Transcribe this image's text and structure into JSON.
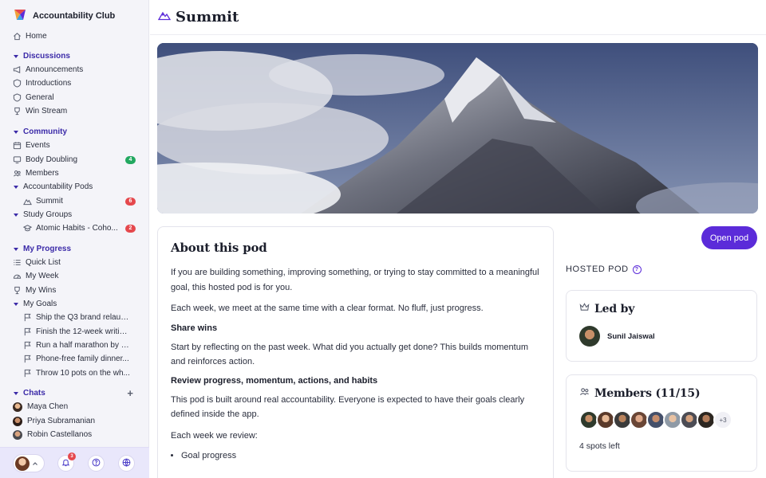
{
  "app": {
    "name": "Accountability Club"
  },
  "colors": {
    "accent": "#5b2bd9",
    "section": "#3b2aa8",
    "badge_green": "#22a860",
    "badge_red": "#e5484d"
  },
  "sidebar": {
    "home": "Home",
    "discussions": {
      "label": "Discussions",
      "items": [
        "Announcements",
        "Introductions",
        "General",
        "Win Stream"
      ]
    },
    "community": {
      "label": "Community",
      "events": "Events",
      "body_doubling": {
        "label": "Body Doubling",
        "badge": "4"
      },
      "members": "Members",
      "pods": {
        "label": "Accountability Pods",
        "items": [
          {
            "label": "Summit",
            "badge": "6"
          }
        ]
      },
      "study_groups": {
        "label": "Study Groups",
        "items": [
          {
            "label": "Atomic Habits - Coho...",
            "badge": "2"
          }
        ]
      }
    },
    "progress": {
      "label": "My Progress",
      "quick_list": "Quick List",
      "my_week": "My Week",
      "my_wins": "My Wins",
      "goals": {
        "label": "My Goals",
        "items": [
          "Ship the Q3 brand relaun...",
          "Finish the 12-week writin...",
          "Run a half marathon by a...",
          "Phone-free family dinner...",
          "Throw 10 pots on the wh..."
        ]
      }
    },
    "chats": {
      "label": "Chats",
      "add": "+",
      "items": [
        "Maya Chen",
        "Priya Subramanian",
        "Robin Castellanos"
      ]
    },
    "footer": {
      "notifications": "3"
    }
  },
  "header": {
    "title": "Summit"
  },
  "about": {
    "title": "About this pod",
    "p1": "If you are building something, improving something, or trying to stay committed to a meaningful goal, this hosted pod is for you.",
    "p2": "Each week, we meet at the same time with a clear format. No fluff, just progress.",
    "h1": "Share wins",
    "p3": "Start by reflecting on the past week. What did you actually get done? This builds momentum and reinforces action.",
    "h2": "Review progress, momentum, actions, and habits",
    "p4": "This pod is built around real accountability. Everyone is expected to have their goals clearly defined inside the app.",
    "p5": "Each week we review:",
    "bullets": [
      "Goal progress"
    ]
  },
  "pod": {
    "open_button": "Open pod",
    "hosted_label": "HOSTED POD",
    "help": "?",
    "led_by": {
      "title": "Led by",
      "leader": "Sunil Jaiswal"
    },
    "members": {
      "title": "Members (11/15)",
      "more": "+3",
      "spots": "4 spots left"
    }
  }
}
